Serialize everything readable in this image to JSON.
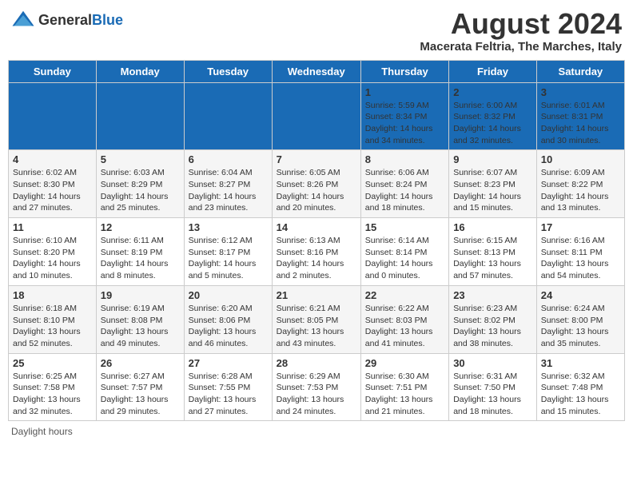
{
  "logo": {
    "text_general": "General",
    "text_blue": "Blue"
  },
  "title": "August 2024",
  "subtitle": "Macerata Feltria, The Marches, Italy",
  "weekdays": [
    "Sunday",
    "Monday",
    "Tuesday",
    "Wednesday",
    "Thursday",
    "Friday",
    "Saturday"
  ],
  "footer": "Daylight hours",
  "weeks": [
    [
      {
        "day": "",
        "info": ""
      },
      {
        "day": "",
        "info": ""
      },
      {
        "day": "",
        "info": ""
      },
      {
        "day": "",
        "info": ""
      },
      {
        "day": "1",
        "info": "Sunrise: 5:59 AM\nSunset: 8:34 PM\nDaylight: 14 hours and 34 minutes."
      },
      {
        "day": "2",
        "info": "Sunrise: 6:00 AM\nSunset: 8:32 PM\nDaylight: 14 hours and 32 minutes."
      },
      {
        "day": "3",
        "info": "Sunrise: 6:01 AM\nSunset: 8:31 PM\nDaylight: 14 hours and 30 minutes."
      }
    ],
    [
      {
        "day": "4",
        "info": "Sunrise: 6:02 AM\nSunset: 8:30 PM\nDaylight: 14 hours and 27 minutes."
      },
      {
        "day": "5",
        "info": "Sunrise: 6:03 AM\nSunset: 8:29 PM\nDaylight: 14 hours and 25 minutes."
      },
      {
        "day": "6",
        "info": "Sunrise: 6:04 AM\nSunset: 8:27 PM\nDaylight: 14 hours and 23 minutes."
      },
      {
        "day": "7",
        "info": "Sunrise: 6:05 AM\nSunset: 8:26 PM\nDaylight: 14 hours and 20 minutes."
      },
      {
        "day": "8",
        "info": "Sunrise: 6:06 AM\nSunset: 8:24 PM\nDaylight: 14 hours and 18 minutes."
      },
      {
        "day": "9",
        "info": "Sunrise: 6:07 AM\nSunset: 8:23 PM\nDaylight: 14 hours and 15 minutes."
      },
      {
        "day": "10",
        "info": "Sunrise: 6:09 AM\nSunset: 8:22 PM\nDaylight: 14 hours and 13 minutes."
      }
    ],
    [
      {
        "day": "11",
        "info": "Sunrise: 6:10 AM\nSunset: 8:20 PM\nDaylight: 14 hours and 10 minutes."
      },
      {
        "day": "12",
        "info": "Sunrise: 6:11 AM\nSunset: 8:19 PM\nDaylight: 14 hours and 8 minutes."
      },
      {
        "day": "13",
        "info": "Sunrise: 6:12 AM\nSunset: 8:17 PM\nDaylight: 14 hours and 5 minutes."
      },
      {
        "day": "14",
        "info": "Sunrise: 6:13 AM\nSunset: 8:16 PM\nDaylight: 14 hours and 2 minutes."
      },
      {
        "day": "15",
        "info": "Sunrise: 6:14 AM\nSunset: 8:14 PM\nDaylight: 14 hours and 0 minutes."
      },
      {
        "day": "16",
        "info": "Sunrise: 6:15 AM\nSunset: 8:13 PM\nDaylight: 13 hours and 57 minutes."
      },
      {
        "day": "17",
        "info": "Sunrise: 6:16 AM\nSunset: 8:11 PM\nDaylight: 13 hours and 54 minutes."
      }
    ],
    [
      {
        "day": "18",
        "info": "Sunrise: 6:18 AM\nSunset: 8:10 PM\nDaylight: 13 hours and 52 minutes."
      },
      {
        "day": "19",
        "info": "Sunrise: 6:19 AM\nSunset: 8:08 PM\nDaylight: 13 hours and 49 minutes."
      },
      {
        "day": "20",
        "info": "Sunrise: 6:20 AM\nSunset: 8:06 PM\nDaylight: 13 hours and 46 minutes."
      },
      {
        "day": "21",
        "info": "Sunrise: 6:21 AM\nSunset: 8:05 PM\nDaylight: 13 hours and 43 minutes."
      },
      {
        "day": "22",
        "info": "Sunrise: 6:22 AM\nSunset: 8:03 PM\nDaylight: 13 hours and 41 minutes."
      },
      {
        "day": "23",
        "info": "Sunrise: 6:23 AM\nSunset: 8:02 PM\nDaylight: 13 hours and 38 minutes."
      },
      {
        "day": "24",
        "info": "Sunrise: 6:24 AM\nSunset: 8:00 PM\nDaylight: 13 hours and 35 minutes."
      }
    ],
    [
      {
        "day": "25",
        "info": "Sunrise: 6:25 AM\nSunset: 7:58 PM\nDaylight: 13 hours and 32 minutes."
      },
      {
        "day": "26",
        "info": "Sunrise: 6:27 AM\nSunset: 7:57 PM\nDaylight: 13 hours and 29 minutes."
      },
      {
        "day": "27",
        "info": "Sunrise: 6:28 AM\nSunset: 7:55 PM\nDaylight: 13 hours and 27 minutes."
      },
      {
        "day": "28",
        "info": "Sunrise: 6:29 AM\nSunset: 7:53 PM\nDaylight: 13 hours and 24 minutes."
      },
      {
        "day": "29",
        "info": "Sunrise: 6:30 AM\nSunset: 7:51 PM\nDaylight: 13 hours and 21 minutes."
      },
      {
        "day": "30",
        "info": "Sunrise: 6:31 AM\nSunset: 7:50 PM\nDaylight: 13 hours and 18 minutes."
      },
      {
        "day": "31",
        "info": "Sunrise: 6:32 AM\nSunset: 7:48 PM\nDaylight: 13 hours and 15 minutes."
      }
    ]
  ]
}
